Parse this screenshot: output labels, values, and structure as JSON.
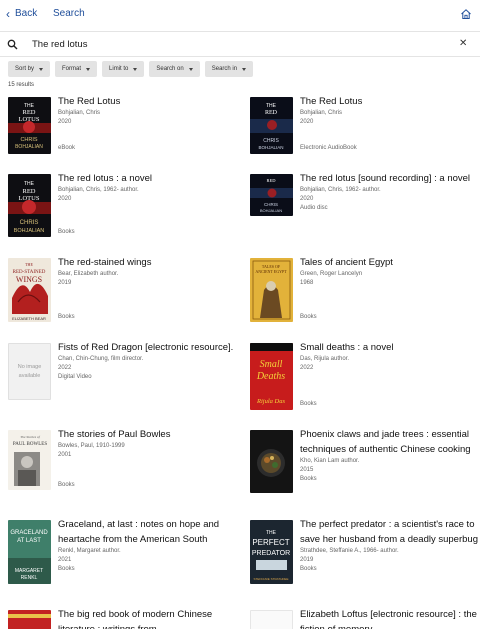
{
  "header": {
    "back_label": "Back",
    "title": "Search"
  },
  "search": {
    "value": "The red lotus",
    "placeholder": ""
  },
  "filters": [
    "Sort by",
    "Format",
    "Limit to",
    "Search on",
    "Search in"
  ],
  "results_count": "15 results",
  "results": [
    {
      "title": "The Red Lotus",
      "meta": [
        "Bohjalian, Chris",
        "2020"
      ],
      "format": "eBook",
      "cover": "redlotus"
    },
    {
      "title": "The Red Lotus",
      "meta": [
        "Bohjalian, Chris",
        "2020"
      ],
      "format": "Electronic AudioBook",
      "cover": "redlotus-dark"
    },
    {
      "title": "The red lotus : a novel",
      "meta": [
        "Bohjalian, Chris, 1962- author.",
        "2020"
      ],
      "format": "Books",
      "cover": "redlotus"
    },
    {
      "title": "The red lotus [sound recording] : a novel",
      "meta": [
        "Bohjalian, Chris, 1962- author.",
        "2020",
        "Audio disc"
      ],
      "format": "",
      "cover": "redlotus-dark"
    },
    {
      "title": "The red-stained wings",
      "meta": [
        "Bear, Elizabeth author.",
        "2019"
      ],
      "format": "Books",
      "cover": "wings"
    },
    {
      "title": "Tales of ancient Egypt",
      "meta": [
        "Green, Roger Lancelyn",
        "1968"
      ],
      "format": "Books",
      "cover": "egypt"
    },
    {
      "title": "Fists of Red Dragon [electronic resource].",
      "meta": [
        "Chan, Chin-Chung, film director.",
        "2022",
        "Digital Video"
      ],
      "format": "",
      "cover": "none",
      "noimage": "No image available"
    },
    {
      "title": "Small deaths : a novel",
      "meta": [
        "Das, Rijula author.",
        "2022"
      ],
      "format": "Books",
      "cover": "smalldeaths"
    },
    {
      "title": "The stories of Paul Bowles",
      "meta": [
        "Bowles, Paul, 1910-1999",
        "2001"
      ],
      "format": "Books",
      "cover": "bowles"
    },
    {
      "title": "Phoenix claws and jade trees : essential techniques of authentic Chinese cooking",
      "meta": [
        "Kho, Kian Lam author.",
        "2015",
        "Books"
      ],
      "format": "",
      "cover": "phoenix"
    },
    {
      "title": "Graceland, at last : notes on hope and heartache from the American South",
      "meta": [
        "Renkl, Margaret author.",
        "2021",
        "Books"
      ],
      "format": "",
      "cover": "graceland"
    },
    {
      "title": "The perfect predator : a scientist's race to save her husband from a deadly superbug",
      "meta": [
        "Strathdee, Steffanie A., 1966- author.",
        "2019",
        "Books"
      ],
      "format": "",
      "cover": "predator"
    },
    {
      "title": "The big red book of modern Chinese literature : writings from",
      "meta": [],
      "format": "",
      "cover": "bigred"
    },
    {
      "title": "Elizabeth Loftus [electronic resource] : the fiction of memory",
      "meta": [],
      "format": "",
      "cover": "loftus"
    }
  ],
  "cover_text": {
    "redlotus": [
      "THE",
      "RED",
      "LOTUS",
      "CHRIS",
      "BOHJALIAN"
    ],
    "wings": [
      "THE",
      "RED-STAINED",
      "WINGS",
      "ELIZABETH BEAR"
    ],
    "egypt": [
      "TALES OF",
      "ANCIENT EGYPT"
    ],
    "smalldeaths": [
      "Small",
      "Deaths",
      "Rijula Das"
    ],
    "bowles": [
      "The Stories of",
      "PAUL BOWLES"
    ],
    "graceland": [
      "GRACELAND",
      "AT LAST",
      "MARGARET",
      "RENKL"
    ],
    "predator": [
      "THE",
      "PERFECT",
      "PREDATOR",
      "STEFFANIE STRATHDEE"
    ]
  },
  "colors": {
    "link": "#1f4e9a",
    "filter_bg": "#e3e3e3"
  }
}
